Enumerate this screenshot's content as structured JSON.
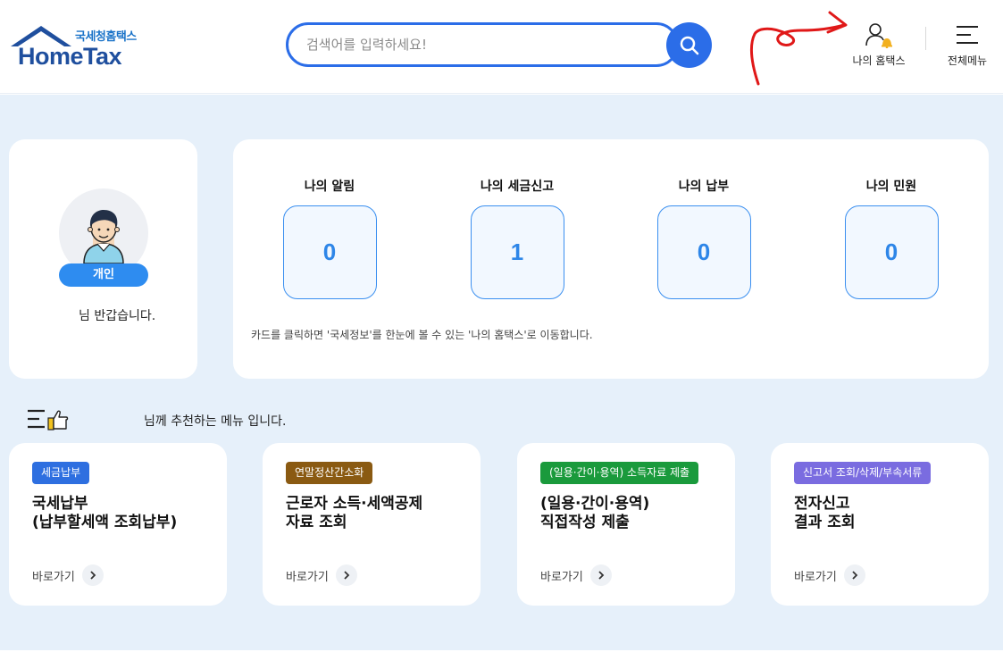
{
  "header": {
    "logo_sub": "국세청홈택스",
    "logo_main": "HomeTax",
    "search_placeholder": "검색어를 입력하세요!",
    "my_hometax_label": "나의 홈택스",
    "all_menu_label": "전체메뉴"
  },
  "profile": {
    "badge": "개인",
    "greeting": "님 반갑습니다."
  },
  "summary": {
    "items": [
      {
        "title": "나의 알림",
        "count": "0"
      },
      {
        "title": "나의 세금신고",
        "count": "1"
      },
      {
        "title": "나의 납부",
        "count": "0"
      },
      {
        "title": "나의 민원",
        "count": "0"
      }
    ],
    "note": "카드를 클릭하면 '국세정보'를 한눈에 볼 수 있는 '나의 홈택스'로 이동합니다."
  },
  "recommend": {
    "text": "님께 추천하는 메뉴 입니다."
  },
  "cards": [
    {
      "tag": "세금납부",
      "tag_color": "#2e6fe0",
      "title_line1": "국세납부",
      "title_line2": "(납부할세액 조회납부)",
      "link": "바로가기"
    },
    {
      "tag": "연말정산간소화",
      "tag_color": "#8a5a12",
      "title_line1": "근로자 소득·세액공제",
      "title_line2": "자료 조회",
      "link": "바로가기"
    },
    {
      "tag": "(일용·간이·용역) 소득자료 제출",
      "tag_color": "#1a9a3c",
      "title_line1": "(일용·간이·용역)",
      "title_line2": "직접작성 제출",
      "link": "바로가기"
    },
    {
      "tag": "신고서 조회/삭제/부속서류",
      "tag_color": "#7a6ce0",
      "title_line1": "전자신고",
      "title_line2": "결과 조회",
      "link": "바로가기"
    }
  ],
  "icons": {
    "search": "search-icon",
    "user_bell": "user-bell-icon",
    "menu": "hamburger-icon",
    "arrow": "chevron-right-icon",
    "thumb": "thumbs-up-list-icon"
  },
  "colors": {
    "primary": "#2b6de8",
    "background": "#e6f0fa",
    "count_text": "#2e86e8"
  }
}
